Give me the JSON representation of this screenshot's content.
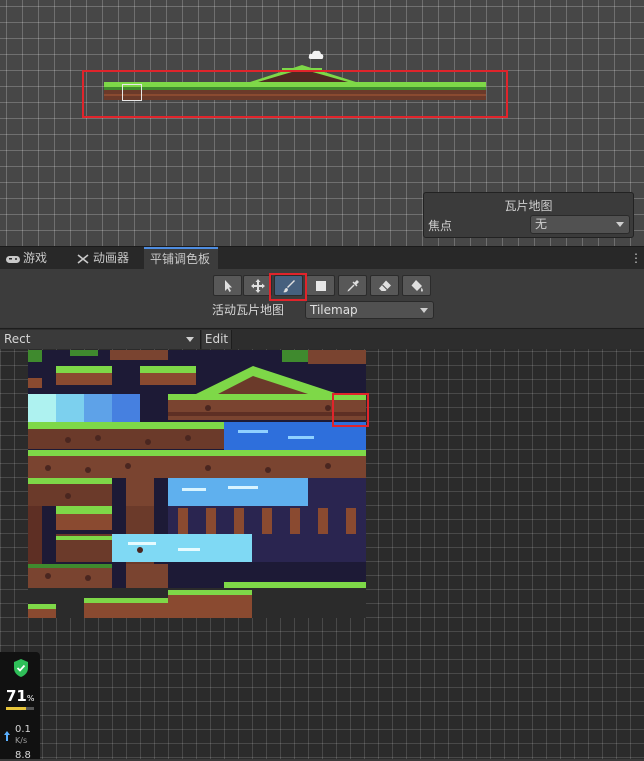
{
  "overlay": {
    "title": "瓦片地图",
    "focus_label": "焦点",
    "focus_value": "无"
  },
  "tabs": [
    {
      "label": "游戏",
      "icon": "gamepad-icon",
      "active": false
    },
    {
      "label": "动画器",
      "icon": "animator-icon",
      "active": false
    },
    {
      "label": "平铺调色板",
      "icon": "",
      "active": true
    }
  ],
  "toolbar": {
    "tools": [
      {
        "name": "select-tool",
        "icon": "arrow-cursor-icon",
        "active": false
      },
      {
        "name": "move-tool",
        "icon": "move-arrows-icon",
        "active": false
      },
      {
        "name": "paint-brush-tool",
        "icon": "brush-icon",
        "active": true
      },
      {
        "name": "box-fill-tool",
        "icon": "square-icon",
        "active": false
      },
      {
        "name": "picker-tool",
        "icon": "eyedropper-icon",
        "active": false
      },
      {
        "name": "eraser-tool",
        "icon": "eraser-icon",
        "active": false
      },
      {
        "name": "fill-tool",
        "icon": "paint-bucket-icon",
        "active": false
      }
    ],
    "active_tilemap_label": "活动瓦片地图",
    "active_tilemap_value": "Tilemap"
  },
  "palette": {
    "selected": "Rect",
    "edit_label": "Edit"
  },
  "perf": {
    "percent": "71",
    "percent_unit": "%",
    "load_fraction": 0.71,
    "upload_speed": "0.1",
    "speed_unit": "K/s",
    "download_speed": "8.8"
  },
  "colors": {
    "accent": "#4f8de0",
    "highlight": "#e0242b",
    "grass": "#7ed848",
    "dirt": "#8a4a30",
    "water": "#5fb0ee"
  }
}
